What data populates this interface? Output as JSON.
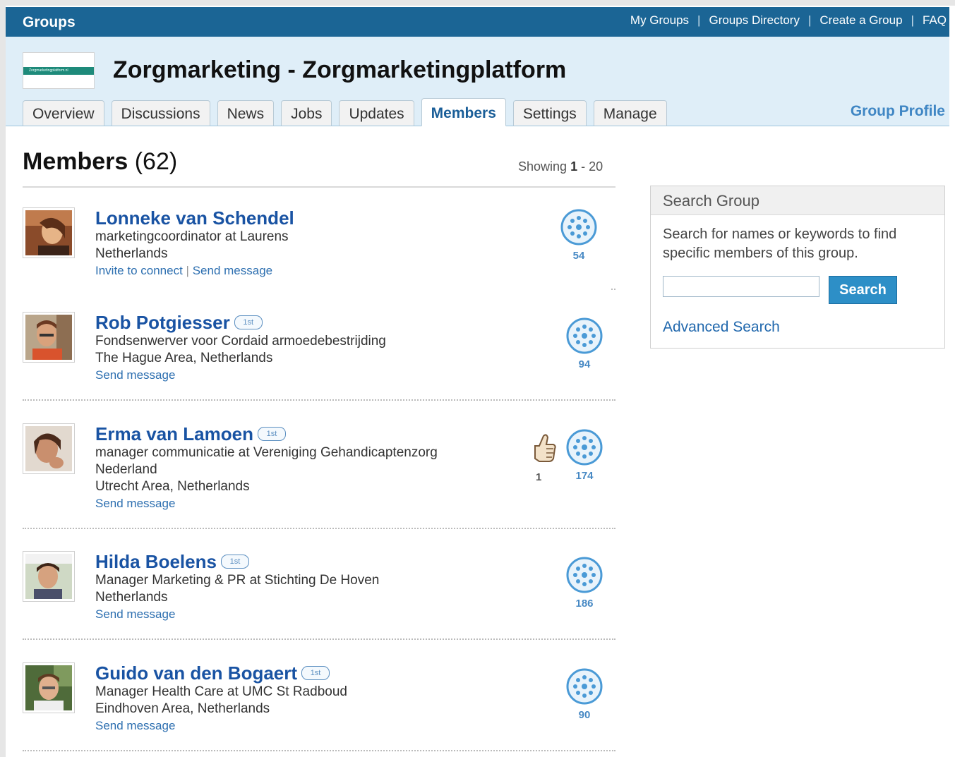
{
  "topbar": {
    "title": "Groups",
    "nav": [
      "My Groups",
      "Groups Directory",
      "Create a Group",
      "FAQ"
    ]
  },
  "group": {
    "logo_text": "Zorgmarketingplatform.nl",
    "title": "Zorgmarketing - Zorgmarketingplatform",
    "tabs": [
      "Overview",
      "Discussions",
      "News",
      "Jobs",
      "Updates",
      "Members",
      "Settings",
      "Manage"
    ],
    "active_tab": "Members",
    "profile_link": "Group Profile"
  },
  "members": {
    "heading": "Members",
    "count": "(62)",
    "showing_prefix": "Showing",
    "showing_range_start": "1",
    "showing_range_end": "- 20",
    "list": [
      {
        "name": "Lonneke van Schendel",
        "degree": "",
        "lines": [
          "marketingcoordinator at Laurens",
          "Netherlands"
        ],
        "actions": [
          "Invite to connect",
          "Send message"
        ],
        "connections": "54",
        "recommendations": ""
      },
      {
        "name": "Rob Potgiesser",
        "degree": "1st",
        "lines": [
          "Fondsenwerver voor Cordaid armoedebestrijding",
          "The Hague Area, Netherlands"
        ],
        "actions": [
          "Send message"
        ],
        "connections": "94",
        "recommendations": ""
      },
      {
        "name": "Erma van Lamoen",
        "degree": "1st",
        "lines": [
          "manager communicatie at Vereniging Gehandicaptenzorg",
          "Nederland",
          "Utrecht Area, Netherlands"
        ],
        "actions": [
          "Send message"
        ],
        "connections": "174",
        "recommendations": "1"
      },
      {
        "name": "Hilda Boelens",
        "degree": "1st",
        "lines": [
          "Manager Marketing & PR at Stichting De Hoven",
          "Netherlands"
        ],
        "actions": [
          "Send message"
        ],
        "connections": "186",
        "recommendations": ""
      },
      {
        "name": "Guido van den Bogaert",
        "degree": "1st",
        "lines": [
          "Manager Health Care at UMC St Radboud",
          "Eindhoven Area, Netherlands"
        ],
        "actions": [
          "Send message"
        ],
        "connections": "90",
        "recommendations": ""
      }
    ]
  },
  "search_group": {
    "heading": "Search Group",
    "description": "Search for names or keywords to find specific members of this group.",
    "input_value": "",
    "button_label": "Search",
    "advanced_link": "Advanced Search"
  },
  "colors": {
    "topbar_bg": "#1b6595",
    "header_bg": "#dfeef8",
    "link": "#1953a3",
    "button": "#2d8fc7"
  }
}
